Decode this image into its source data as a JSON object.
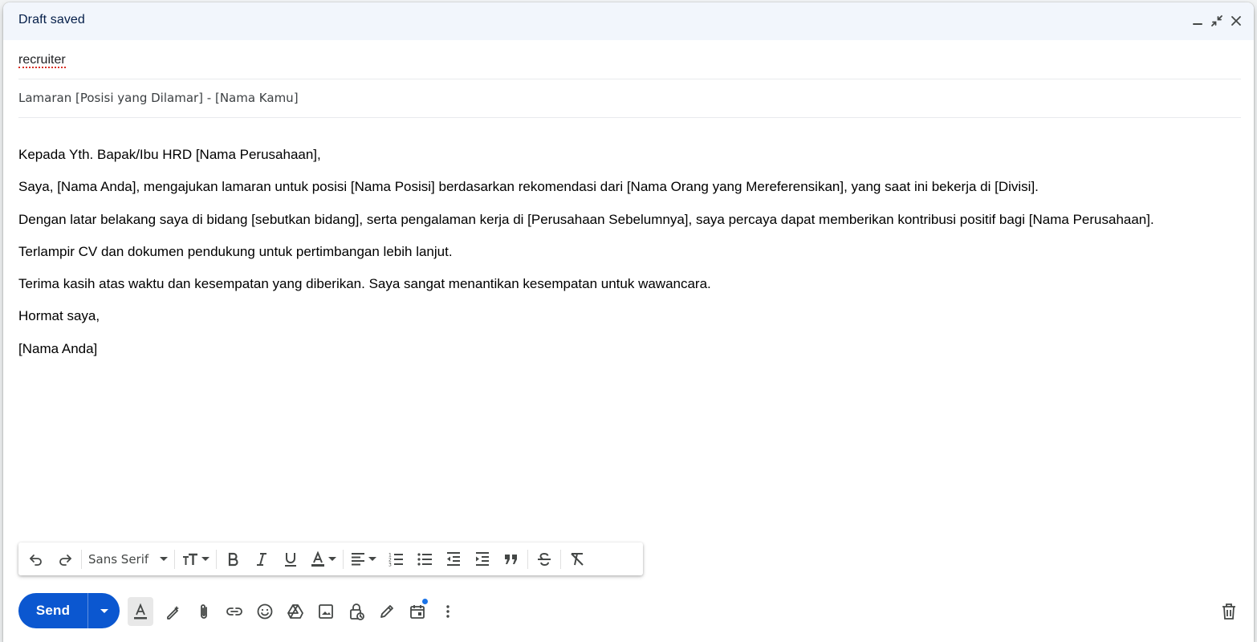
{
  "header": {
    "title": "Draft saved"
  },
  "to": {
    "recipient": "recruiter"
  },
  "subject": {
    "value": "Lamaran [Posisi yang Dilamar] - [Nama Kamu]"
  },
  "body": {
    "lines": [
      "Kepada Yth. Bapak/Ibu HRD [Nama Perusahaan],",
      "Saya, [Nama Anda], mengajukan lamaran untuk posisi [Nama Posisi] berdasarkan rekomendasi dari [Nama Orang yang Mereferensikan], yang saat ini bekerja di [Divisi].",
      "Dengan latar belakang saya di bidang [sebutkan bidang], serta pengalaman kerja di [Perusahaan Sebelumnya], saya percaya dapat memberikan kontribusi positif bagi [Nama Perusahaan].",
      "Terlampir CV dan dokumen pendukung untuk pertimbangan lebih lanjut.",
      "Terima kasih atas waktu dan kesempatan yang diberikan. Saya sangat menantikan kesempatan untuk wawancara.",
      "Hormat saya,",
      "[Nama Anda]"
    ]
  },
  "formatting": {
    "font": "Sans Serif"
  },
  "send": {
    "label": "Send"
  },
  "colors": {
    "accent": "#0b57d0",
    "header_bg": "#f2f6fc",
    "notification_dot": "#1a73e8"
  },
  "icons": {
    "header": [
      "minimize-icon",
      "exit-fullscreen-icon",
      "close-icon"
    ],
    "format_bar": [
      "undo-icon",
      "redo-icon",
      "text-size-icon",
      "bold-icon",
      "italic-icon",
      "underline-icon",
      "text-color-icon",
      "align-icon",
      "numbered-list-icon",
      "bulleted-list-icon",
      "indent-less-icon",
      "indent-more-icon",
      "quote-icon",
      "strikethrough-icon",
      "remove-formatting-icon"
    ],
    "bottom": [
      "formatting-toggle-icon",
      "help-me-write-icon",
      "attach-icon",
      "link-icon",
      "emoji-icon",
      "drive-icon",
      "photo-icon",
      "confidential-icon",
      "signature-icon",
      "schedule-icon",
      "more-options-icon",
      "trash-icon"
    ]
  }
}
